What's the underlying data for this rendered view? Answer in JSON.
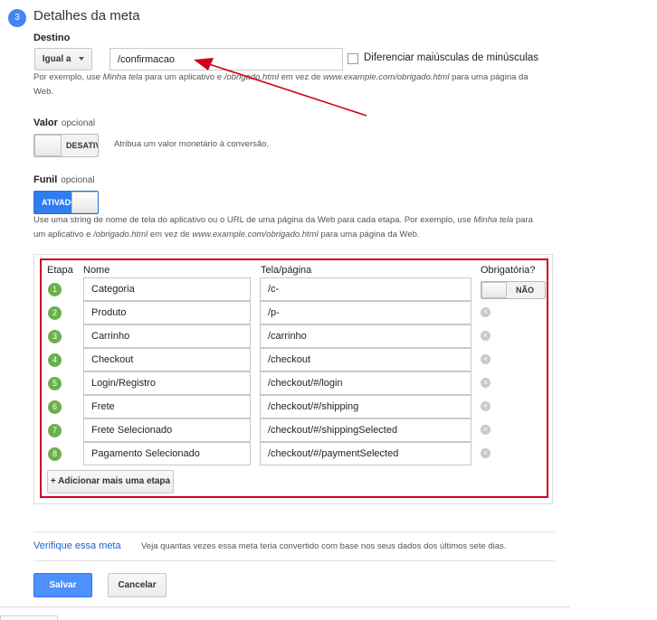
{
  "section": {
    "number": "3",
    "title": "Detalhes da meta"
  },
  "destino": {
    "label": "Destino",
    "match_type": "Igual a",
    "value": "/confirmacao",
    "case_sensitive_label": "Diferenciar maiúsculas de minúsculas",
    "case_sensitive_checked": false,
    "help_1": "Por exemplo, use",
    "help_em_1": "Minha tela",
    "help_2": "para um aplicativo e",
    "help_em_2": "/obrigado.html",
    "help_3": "em vez de",
    "help_em_3": "www.example.com/obrigado.html",
    "help_4": "para uma página da",
    "help_5": "Web."
  },
  "valor": {
    "label": "Valor",
    "optional": "opcional",
    "toggle_text": "DESATIVADO",
    "toggle_on": false,
    "help": "Atribua um valor monetário à conversão."
  },
  "funil": {
    "label": "Funil",
    "optional": "opcional",
    "toggle_text": "ATIVADO",
    "toggle_on": true,
    "help_1a": "Use uma string de nome de tela do aplicativo ou o URL de uma página da Web para cada etapa. Por exemplo, use",
    "help_em_1": "Minha tela",
    "help_1b": "para",
    "help_2a": "um aplicativo e",
    "help_em_2": "/obrigado.html",
    "help_2b": "em vez de",
    "help_em_3": "www.example.com/obrigado.html",
    "help_2c": "para uma página da Web.",
    "columns": {
      "etapa": "Etapa",
      "nome": "Nome",
      "tela": "Tela/página",
      "obrigatoria": "Obrigatória?"
    },
    "required_toggle_text": "NÃO",
    "steps": [
      {
        "n": "1",
        "name": "Categoria",
        "page": "/c-"
      },
      {
        "n": "2",
        "name": "Produto",
        "page": "/p-"
      },
      {
        "n": "3",
        "name": "Carrinho",
        "page": "/carrinho"
      },
      {
        "n": "4",
        "name": "Checkout",
        "page": "/checkout"
      },
      {
        "n": "5",
        "name": "Login/Registro",
        "page": "/checkout/#/login"
      },
      {
        "n": "6",
        "name": "Frete",
        "page": "/checkout/#/shipping"
      },
      {
        "n": "7",
        "name": "Frete Selecionado",
        "page": "/checkout/#/shippingSelected"
      },
      {
        "n": "8",
        "name": "Pagamento Selecionado",
        "page": "/checkout/#/paymentSelected"
      }
    ],
    "add_step": "+ Adicionar mais uma etapa"
  },
  "verify": {
    "link": "Verifique essa meta",
    "text": "Veja quantas vezes essa meta teria convertido com base nos seus dados dos últimos sete dias."
  },
  "actions": {
    "save": "Salvar",
    "cancel": "Cancelar"
  },
  "colors": {
    "accent": "#4285f4",
    "save": "#4d90fe",
    "step_badge": "#6ab04c",
    "annotation": "#d0021b"
  }
}
